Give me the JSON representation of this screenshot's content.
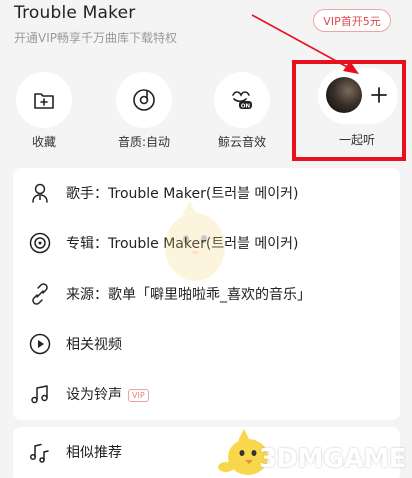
{
  "header": {
    "song_title": "Trouble Maker",
    "vip_subtitle": "开通VIP畅享千万曲库下载特权",
    "vip_button": "VIP首开5元"
  },
  "actions": [
    {
      "label": "收藏",
      "icon": "collect-folder-plus-icon"
    },
    {
      "label": "音质:自动",
      "icon": "quality-disc-icon"
    },
    {
      "label": "鲸云音效",
      "icon": "whale-sound-effect-icon"
    },
    {
      "label": "一起听",
      "icon": "listen-together-avatar-plus"
    }
  ],
  "menu": [
    {
      "text": "歌手：Trouble Maker(트러블 메이커)",
      "icon": "singer-icon"
    },
    {
      "text": "专辑：Trouble Maker(트러블 메이커)",
      "icon": "album-disc-icon"
    },
    {
      "text": "来源：歌单「噼里啪啦乖_喜欢的音乐」",
      "icon": "source-link-icon"
    },
    {
      "text": "相关视频",
      "icon": "video-play-icon"
    },
    {
      "text": "设为铃声",
      "icon": "ringtone-icon",
      "badge": "VIP"
    }
  ],
  "menu2": [
    {
      "text": "相似推荐",
      "icon": "similar-recommend-icon"
    }
  ],
  "watermark": {
    "text": "3DMGAME"
  },
  "colors": {
    "accent_red": "#e8101c",
    "vip_red": "#e1484f",
    "background": "#f4f4f4"
  }
}
